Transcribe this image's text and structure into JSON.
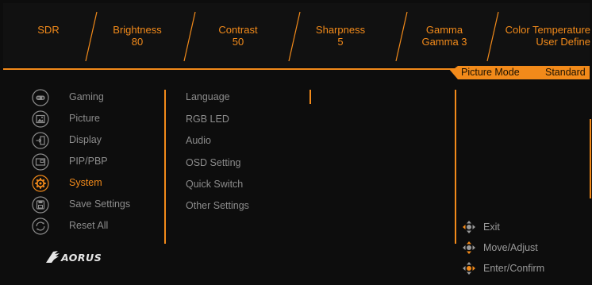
{
  "status_bar": {
    "mode": "SDR",
    "brightness": {
      "label": "Brightness",
      "value": "80"
    },
    "contrast": {
      "label": "Contrast",
      "value": "50"
    },
    "sharpness": {
      "label": "Sharpness",
      "value": "5"
    },
    "gamma": {
      "label": "Gamma",
      "value": "Gamma 3"
    },
    "color_temperature": {
      "label": "Color Temperature",
      "value": "User Define"
    }
  },
  "picture_mode": {
    "label": "Picture Mode",
    "value": "Standard"
  },
  "main_menu": {
    "items": [
      {
        "label": "Gaming",
        "icon": "gamepad-icon",
        "active": false
      },
      {
        "label": "Picture",
        "icon": "picture-icon",
        "active": false
      },
      {
        "label": "Display",
        "icon": "display-input-icon",
        "active": false
      },
      {
        "label": "PIP/PBP",
        "icon": "pip-icon",
        "active": false
      },
      {
        "label": "System",
        "icon": "gear-icon",
        "active": true
      },
      {
        "label": "Save Settings",
        "icon": "save-icon",
        "active": false
      },
      {
        "label": "Reset All",
        "icon": "reset-icon",
        "active": false
      }
    ]
  },
  "submenu": {
    "items": [
      {
        "label": "Language"
      },
      {
        "label": "RGB LED"
      },
      {
        "label": "Audio"
      },
      {
        "label": "OSD Setting"
      },
      {
        "label": "Quick Switch"
      },
      {
        "label": "Other Settings"
      }
    ]
  },
  "hints": [
    {
      "label": "Exit",
      "icon": "joystick-exit-icon"
    },
    {
      "label": "Move/Adjust",
      "icon": "joystick-move-icon"
    },
    {
      "label": "Enter/Confirm",
      "icon": "joystick-press-icon"
    }
  ],
  "logo": {
    "text": "AORUS",
    "icon": "aorus-eagle-icon"
  },
  "colors": {
    "accent": "#f28a1a",
    "text_inactive": "#8c8c8c",
    "background": "#0d0d0d"
  }
}
